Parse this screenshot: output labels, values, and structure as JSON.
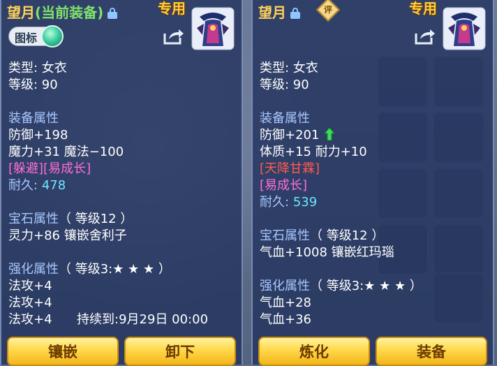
{
  "left": {
    "name": "望月",
    "current_tag": "(当前装备)",
    "exclusive": "专用",
    "icon_toggle_label": "图标",
    "type_line": "类型:  女衣",
    "level_line": "等级:  90",
    "equip_attr_heading": "装备属性",
    "attrs": [
      "防御+198",
      "魔力+31  魔法−100"
    ],
    "special": "[躲避][易成长]",
    "durability_label": "耐久:",
    "durability_value": "478",
    "gem_heading": "宝石属性",
    "gem_level": "（ 等级12 ）",
    "gem_line": "灵力+86  镶嵌舍利子",
    "enhance_heading": "强化属性",
    "enhance_level": "（ 等级3:★ ★ ★ ）",
    "enhance_lines": [
      "法攻+4",
      "法攻+4",
      "法攻+4"
    ],
    "duration": "持续到:9月29日  00:00",
    "buttons": [
      "镶嵌",
      "卸下"
    ]
  },
  "right": {
    "name": "望月",
    "rate_badge": "评",
    "exclusive": "专用",
    "type_line": "类型:  女衣",
    "level_line": "等级:  90",
    "equip_attr_heading": "装备属性",
    "attrs": [
      "防御+201",
      "体质+15  耐力+10"
    ],
    "special_1": "[天降甘霖]",
    "special_2": "[易成长]",
    "durability_label": "耐久:",
    "durability_value": "539",
    "gem_heading": "宝石属性",
    "gem_level": "（ 等级12 ）",
    "gem_line": "气血+1008  镶嵌红玛瑙",
    "enhance_heading": "强化属性",
    "enhance_level": "（ 等级3:★ ★ ★ ）",
    "enhance_lines": [
      "气血+28",
      "气血+36"
    ],
    "buttons": [
      "炼化",
      "装备"
    ]
  },
  "colors": {
    "title": "#ffd25a",
    "current_tag": "#7fe36b",
    "heading": "#a8c8ff",
    "durability": "#6fe6ff",
    "special_pink": "#ff6fd6",
    "special_red": "#ff5a4e"
  }
}
